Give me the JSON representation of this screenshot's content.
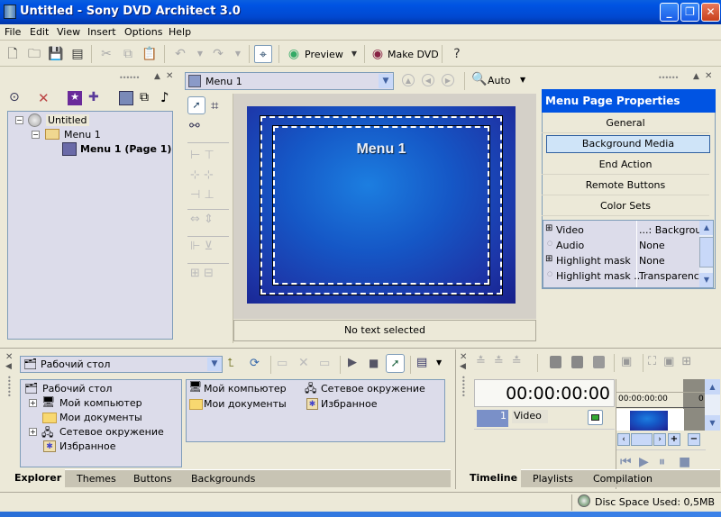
{
  "window": {
    "title": "Untitled - Sony DVD Architect 3.0",
    "minimize": "_",
    "restore": "❐",
    "close": "✕"
  },
  "menu": [
    "File",
    "Edit",
    "View",
    "Insert",
    "Options",
    "Help"
  ],
  "toolbar": {
    "preview_label": "Preview",
    "make_dvd_label": "Make DVD"
  },
  "project_tree": {
    "root": "Untitled",
    "menu": "Menu 1",
    "page": "Menu 1 (Page 1)"
  },
  "editor": {
    "menu_select": "Menu 1",
    "zoom_label": "Auto",
    "canvas_title": "Menu 1",
    "status": "No text selected"
  },
  "properties": {
    "title": "Menu Page Properties",
    "buttons": [
      "General",
      "Background Media",
      "End Action",
      "Remote Buttons",
      "Color Sets"
    ],
    "selected": "Background Media",
    "rows": [
      {
        "name": "Video",
        "value": "...: Backgrour",
        "expandable": true
      },
      {
        "name": "Audio",
        "value": "None",
        "expandable": false
      },
      {
        "name": "Highlight mask",
        "value": "None",
        "expandable": true
      },
      {
        "name": "Highlight mask ...",
        "value": "Transparency",
        "expandable": false
      }
    ]
  },
  "explorer": {
    "location": "Рабочий стол",
    "tree": [
      "Рабочий стол",
      "Мой компьютер",
      "Мои документы",
      "Сетевое окружение",
      "Избранное"
    ],
    "files": [
      "Мой компьютер",
      "Мои документы",
      "Сетевое окружение",
      "Избранное"
    ],
    "tabs": [
      "Explorer",
      "Themes",
      "Buttons",
      "Backgrounds"
    ],
    "active_tab": "Explorer"
  },
  "timeline": {
    "timecode": "00:00:00:00",
    "ruler_time": "00:00:00:00",
    "ruler_end": "0",
    "track_number": "1",
    "track_name": "Video",
    "tabs": [
      "Timeline",
      "Playlists",
      "Compilation"
    ],
    "active_tab": "Timeline"
  },
  "statusbar": {
    "disc_space": "Disc Space Used: 0,5MB"
  }
}
